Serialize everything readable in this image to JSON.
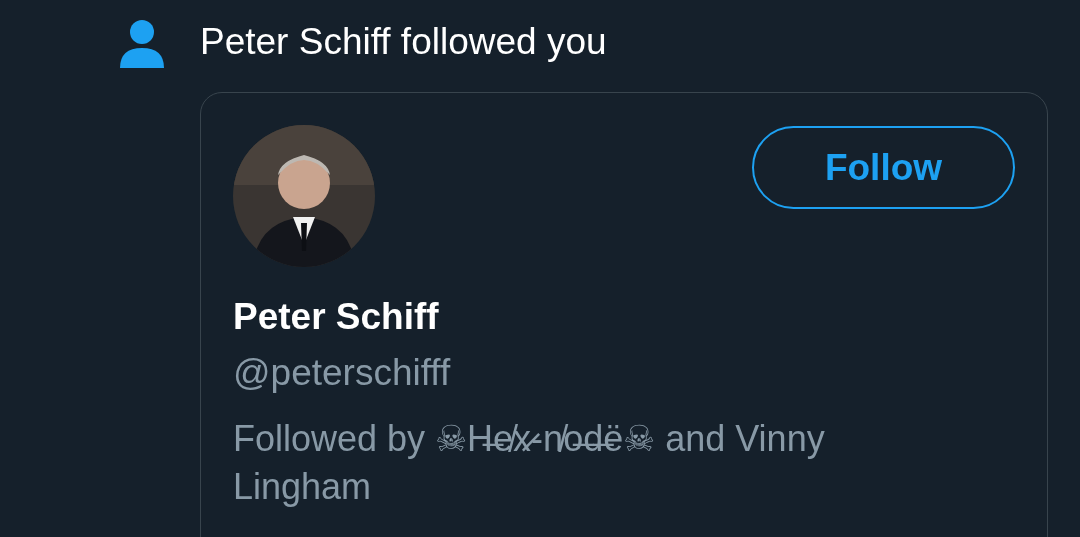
{
  "notification": {
    "text": "Peter Schiff followed you"
  },
  "card": {
    "follow_button": "Follow",
    "name": "Peter Schiff",
    "handle": "@peterschifff",
    "followed_by": "Followed by ☠H̶e̸x̷-n̸o̶d̶ë☠ and Vinny Lingham"
  }
}
